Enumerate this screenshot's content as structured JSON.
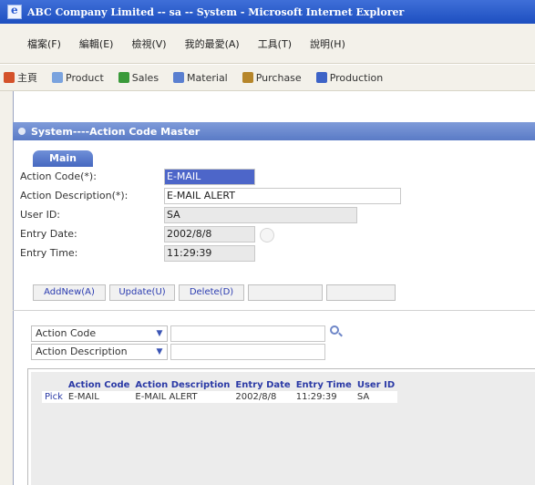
{
  "window": {
    "title": "ABC Company Limited -- sa -- System - Microsoft Internet Explorer"
  },
  "menubar": {
    "items": [
      "檔案(F)",
      "編輯(E)",
      "檢視(V)",
      "我的最愛(A)",
      "工具(T)",
      "說明(H)"
    ]
  },
  "toolbar": {
    "items": [
      {
        "label": "主頁",
        "icon": "home-icon",
        "color": "#d4522b"
      },
      {
        "label": "Product",
        "icon": "product-icon",
        "color": "#7aa3de"
      },
      {
        "label": "Sales",
        "icon": "sales-icon",
        "color": "#3a9a3a"
      },
      {
        "label": "Material",
        "icon": "material-icon",
        "color": "#5a7fd0"
      },
      {
        "label": "Purchase",
        "icon": "purchase-icon",
        "color": "#b6862b"
      },
      {
        "label": "Production",
        "icon": "production-icon",
        "color": "#3d63c7"
      }
    ]
  },
  "page": {
    "header": "System----Action Code Master"
  },
  "tab": {
    "label": "Main"
  },
  "form": {
    "action_code": {
      "label": "Action Code(*):",
      "value": "E-MAIL"
    },
    "action_desc": {
      "label": "Action Description(*):",
      "value": "E-MAIL ALERT"
    },
    "user_id": {
      "label": "User ID:",
      "value": "SA"
    },
    "entry_date": {
      "label": "Entry Date:",
      "value": "2002/8/8"
    },
    "entry_time": {
      "label": "Entry Time:",
      "value": "11:29:39"
    }
  },
  "buttons": {
    "addnew": "AddNew(A)",
    "update": "Update(U)",
    "delete": "Delete(D)"
  },
  "filter": {
    "first": {
      "selected": "Action Code",
      "value": ""
    },
    "second": {
      "selected": "Action Description",
      "value": ""
    }
  },
  "grid": {
    "headers": [
      "",
      "Action Code",
      "Action Description",
      "Entry Date",
      "Entry Time",
      "User ID"
    ],
    "rows": [
      [
        "Pick",
        "E-MAIL",
        "E-MAIL ALERT",
        "2002/8/8",
        "11:29:39",
        "SA"
      ]
    ]
  }
}
